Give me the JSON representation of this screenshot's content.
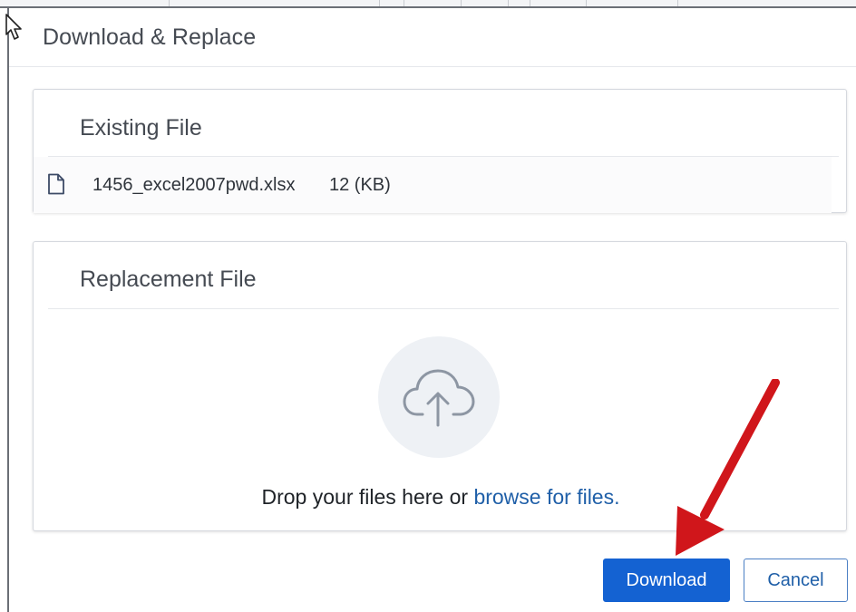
{
  "dialog": {
    "title": "Download & Replace"
  },
  "existing_file": {
    "heading": "Existing File",
    "icon": "document-icon",
    "file_name": "1456_excel2007pwd.xlsx",
    "file_size": "12 (KB)"
  },
  "replacement_file": {
    "heading": "Replacement File",
    "icon": "cloud-upload-icon",
    "drop_text": "Drop your files here or",
    "browse_link": "browse for files."
  },
  "actions": {
    "download_label": "Download",
    "cancel_label": "Cancel"
  },
  "colors": {
    "primary": "#1462d2",
    "link": "#1f5fa8",
    "annotation_arrow": "#d0161b"
  }
}
